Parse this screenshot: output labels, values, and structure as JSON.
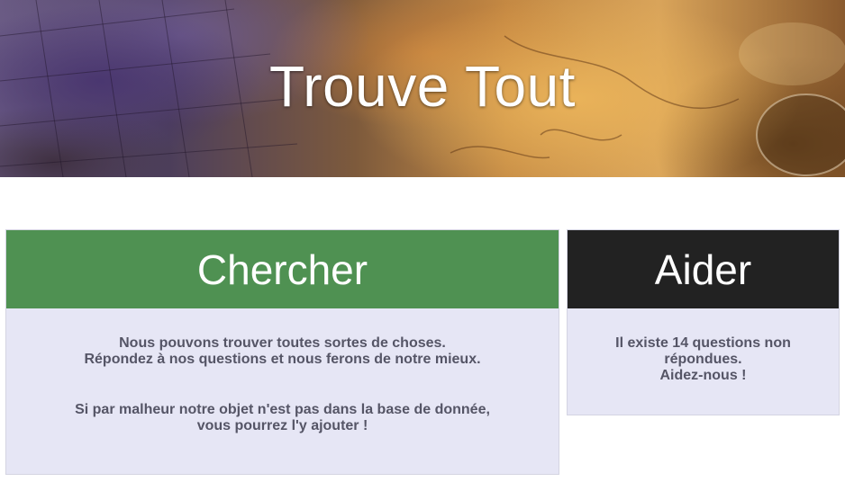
{
  "header": {
    "title": "Trouve Tout"
  },
  "search_panel": {
    "title": "Chercher",
    "paragraph1": {
      "line1": "Nous pouvons trouver toutes sortes de choses.",
      "line2": "Répondez à nos questions et nous ferons de notre mieux."
    },
    "paragraph2": {
      "line1": "Si par malheur notre objet n'est pas dans la base de donnée,",
      "line2": "vous pourrez l'y ajouter !"
    }
  },
  "help_panel": {
    "title": "Aider",
    "line1": "Il existe 14 questions non",
    "line2": "répondues.",
    "line3": "Aidez-nous !"
  },
  "colors": {
    "search_header": "#4f9152",
    "help_header": "#222222",
    "card_background": "#e6e6f5",
    "body_text": "#555566"
  }
}
